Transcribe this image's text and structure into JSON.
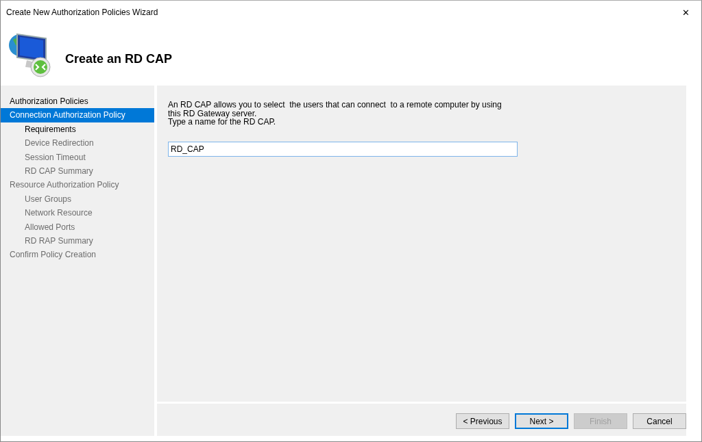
{
  "window": {
    "title": "Create New Authorization Policies Wizard",
    "close": "✕"
  },
  "header": {
    "title": "Create an RD CAP"
  },
  "steps": [
    {
      "label": "Authorization Policies",
      "selected": false,
      "disabled": false
    },
    {
      "label": "Connection Authorization Policy",
      "selected": true,
      "disabled": false,
      "children": [
        {
          "label": "Requirements",
          "selected": false,
          "disabled": false
        },
        {
          "label": "Device Redirection",
          "selected": false,
          "disabled": true
        },
        {
          "label": "Session Timeout",
          "selected": false,
          "disabled": true
        },
        {
          "label": "RD CAP Summary",
          "selected": false,
          "disabled": true
        }
      ]
    },
    {
      "label": "Resource Authorization Policy",
      "selected": false,
      "disabled": true,
      "children": [
        {
          "label": "User Groups",
          "selected": false,
          "disabled": true
        },
        {
          "label": "Network Resource",
          "selected": false,
          "disabled": true
        },
        {
          "label": "Allowed Ports",
          "selected": false,
          "disabled": true
        },
        {
          "label": "RD RAP Summary",
          "selected": false,
          "disabled": true
        }
      ]
    },
    {
      "label": "Confirm Policy Creation",
      "selected": false,
      "disabled": true
    }
  ],
  "description": [
    "An RD CAP allows you to select  the users that can connect  to a remote computer by using",
    "this RD Gateway server.",
    "Type a name for the RD CAP."
  ],
  "name_field": {
    "value": "RD_CAP"
  },
  "buttons": [
    {
      "label": "< Previous",
      "disabled": false,
      "default": false
    },
    {
      "label": "Next >",
      "disabled": false,
      "default": true
    },
    {
      "label": "Finish",
      "disabled": true,
      "default": false
    },
    {
      "label": "Cancel",
      "disabled": false,
      "default": false
    }
  ]
}
